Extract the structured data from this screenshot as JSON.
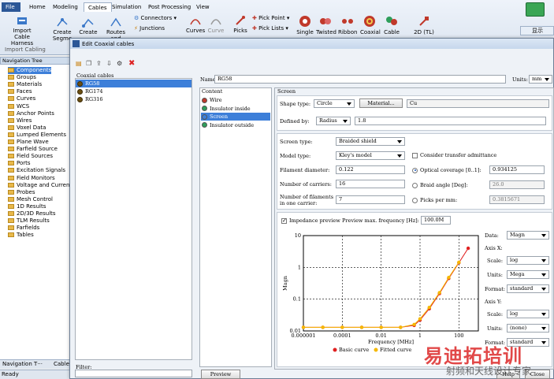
{
  "ribbon": {
    "tabs": [
      "File",
      "Home",
      "Modeling",
      "Cables",
      "Simulation",
      "Post Processing",
      "View"
    ],
    "active_tab": "Cables",
    "buttons": {
      "import_cable": "Import Cable Harness",
      "import_group": "Import Cabling",
      "create_segment": "Create Segme",
      "create": "Create",
      "routes": "Routes and",
      "connectors": "Connectors",
      "junctions": "Junctions",
      "curves": "Curves",
      "curve": "Curve",
      "picks": "Picks",
      "pick_point": "Pick Point",
      "pick_lists": "Pick Lists",
      "single": "Single",
      "twisted": "Twisted",
      "ribbon_btn": "Ribbon",
      "coaxial": "Coaxial",
      "cable": "Cable",
      "twod": "2D (TL)"
    },
    "right_btn": "显示"
  },
  "nav_tree": {
    "title": "Navigation Tree",
    "items": [
      "Components",
      "Groups",
      "Materials",
      "Faces",
      "Curves",
      "WCS",
      "Anchor Points",
      "Wires",
      "Voxel Data",
      "Lumped Elements",
      "Plane Wave",
      "Farfield Source",
      "Field Sources",
      "Ports",
      "Excitation Signals",
      "Field Monitors",
      "Voltage and Current",
      "Probes",
      "Mesh Control",
      "1D Results",
      "2D/3D Results",
      "TLM Results",
      "Farfields",
      "Tables"
    ],
    "bottom_tabs": [
      "Navigation T···",
      "Cable"
    ],
    "status": "Ready"
  },
  "dialog": {
    "title": "Edit Coaxial cables",
    "list_title": "Coaxial cables",
    "cables": [
      "RG58",
      "RG174",
      "RG316"
    ],
    "filter_label": "Filter:",
    "name_label": "Name",
    "name_value": "RG58",
    "units_label": "Units:",
    "units_value": "mm",
    "content_title": "Content",
    "content_items": [
      "Wire",
      "Insulator inside",
      "Screen",
      "Insulator outside"
    ],
    "screen_title": "Screen",
    "shape_label": "Shape type:",
    "shape_value": "Circle",
    "material_btn": "Material...",
    "material_value": "Cu",
    "defined_label": "Defined by:",
    "defined_value": "Radius",
    "defined_num": "1.8",
    "screen_type_label": "Screen type:",
    "screen_type_value": "Braided shield",
    "model_type_label": "Model type:",
    "model_type_value": "Kley's model",
    "transfer_label": "Consider transfer admittance",
    "filament_label": "Filament diameter:",
    "filament_value": "0.122",
    "optical_label": "Optical coverage [0..1]:",
    "optical_value": "0.934125",
    "carriers_label": "Number of carriers:",
    "carriers_value": "16",
    "braid_label": "Braid angle [Deg]:",
    "braid_value": "26.0",
    "filaments_label1": "Number of filaments",
    "filaments_label2": "in one carrier:",
    "filaments_value": "7",
    "picks_label": "Picks per mm:",
    "picks_value": "0.3815671",
    "impedance_label": "Impedance preview",
    "preview_freq_label": "Preview max. frequency [Hz]:",
    "preview_freq_value": "100.0M",
    "preview_btn": "Preview",
    "help_btn": "Help",
    "close_btn": "Close",
    "side": {
      "data_label": "Data:",
      "data_value": "Magn",
      "axisx": "Axis X:",
      "scale_label": "Scale:",
      "scale_x": "log",
      "units_label": "Units:",
      "units_x": "Mega",
      "format_label": "Format:",
      "format_x": "standard",
      "axisy": "Axis Y:",
      "scale_y": "log",
      "units_y": "(none)",
      "format_y": "standard"
    }
  },
  "chart_data": {
    "type": "line",
    "xlabel": "Frequency [MHz]",
    "ylabel": "Magn",
    "x_scale": "log",
    "y_scale": "log",
    "xlim": [
      1e-06,
      1000
    ],
    "ylim": [
      0.01,
      10
    ],
    "x_ticks": [
      "0.000001",
      "0.0001",
      "0.01",
      "1",
      "100"
    ],
    "y_ticks": [
      "0.01",
      "0.1",
      "1",
      "10"
    ],
    "grid": true,
    "legend": "bottom",
    "series": [
      {
        "name": "Basic curve",
        "color": "#e02020",
        "x": [
          1e-06,
          1e-05,
          0.0001,
          0.001,
          0.01,
          0.1,
          0.5,
          1,
          3,
          10,
          30,
          100,
          300
        ],
        "y": [
          0.013,
          0.013,
          0.013,
          0.013,
          0.013,
          0.013,
          0.015,
          0.022,
          0.05,
          0.15,
          0.45,
          1.4,
          4.0
        ]
      },
      {
        "name": "Fitted curve",
        "color": "#f5b800",
        "x": [
          1e-06,
          1e-05,
          0.0001,
          0.001,
          0.01,
          0.1,
          0.5,
          1,
          3,
          10,
          30,
          100
        ],
        "y": [
          0.013,
          0.013,
          0.013,
          0.013,
          0.013,
          0.013,
          0.016,
          0.024,
          0.055,
          0.16,
          0.48,
          1.45
        ]
      }
    ]
  },
  "watermark": {
    "text1": "易迪拓培训",
    "text2": "射频和天线设计专家"
  }
}
